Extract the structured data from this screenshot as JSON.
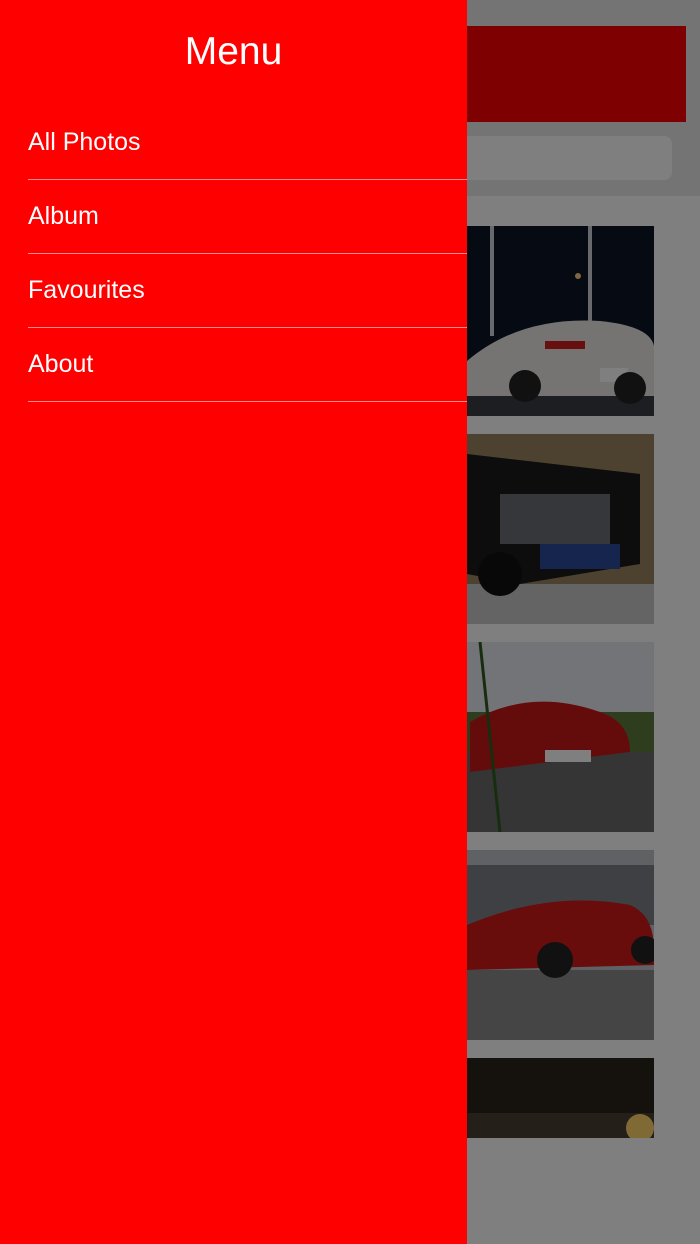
{
  "menu": {
    "title": "Menu",
    "items": [
      {
        "label": "All Photos"
      },
      {
        "label": "Album"
      },
      {
        "label": "Favourites"
      },
      {
        "label": "About"
      }
    ]
  },
  "colors": {
    "accent": "#ff0000",
    "overlay": "#000000"
  }
}
